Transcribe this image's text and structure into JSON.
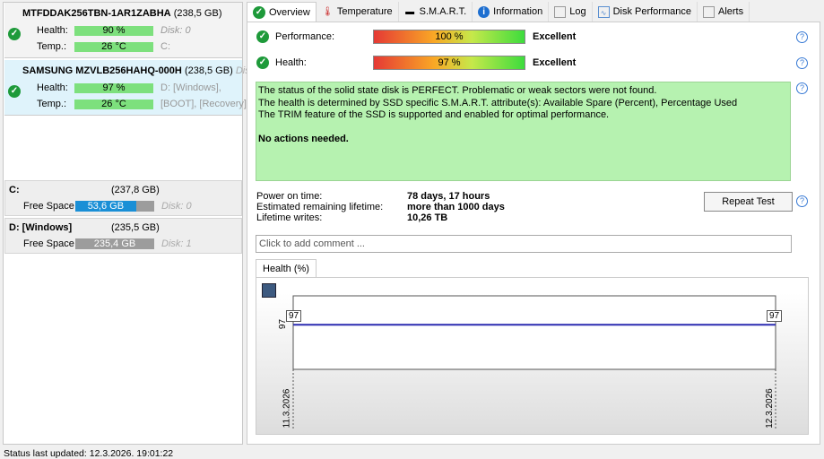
{
  "disks": [
    {
      "name": "MTFDDAK256TBN-1AR1ZABHA",
      "size": "(238,5 GB)",
      "extra": "",
      "health_label": "Health:",
      "health": "90 %",
      "temp_label": "Temp.:",
      "temp": "26 °C",
      "note1": "Disk: 0",
      "note2": "C:"
    },
    {
      "name": "SAMSUNG MZVLB256HAHQ-000H",
      "size": "(238,5 GB)",
      "extra": "Dis",
      "health_label": "Health:",
      "health": "97 %",
      "temp_label": "Temp.:",
      "temp": "26 °C",
      "note1": "D: [Windows],",
      "note2": "[BOOT], [Recovery]"
    }
  ],
  "volumes": [
    {
      "name": "C:",
      "size": "(237,8 GB)",
      "free_label": "Free Space",
      "free": "53,6 GB",
      "free_fraction": 0.77,
      "fill_color": "#1a8fd6",
      "disk": "Disk: 0"
    },
    {
      "name": "D: [Windows]",
      "size": "(235,5 GB)",
      "free_label": "Free Space",
      "free": "235,4 GB",
      "free_fraction": 1.0,
      "fill_color": "#9c9c9c",
      "disk": "Disk: 1"
    }
  ],
  "tabs": [
    "Overview",
    "Temperature",
    "S.M.A.R.T.",
    "Information",
    "Log",
    "Disk Performance",
    "Alerts"
  ],
  "overview": {
    "performance_label": "Performance:",
    "performance": "100 %",
    "performance_rating": "Excellent",
    "health_label": "Health:",
    "health": "97 %",
    "health_rating": "Excellent",
    "status_lines": [
      "The status of the solid state disk is PERFECT. Problematic or weak sectors were not found.",
      "The health is determined by SSD specific S.M.A.R.T. attribute(s):  Available Spare (Percent), Percentage Used",
      "The TRIM feature of the SSD is supported and enabled for optimal performance."
    ],
    "status_action": "No actions needed.",
    "power_on_label": "Power on time:",
    "power_on": "78 days, 17 hours",
    "remaining_label": "Estimated remaining lifetime:",
    "remaining": "more than 1000 days",
    "writes_label": "Lifetime writes:",
    "writes": "10,26 TB",
    "repeat_test": "Repeat Test",
    "comment_placeholder": "Click to add comment ...",
    "chart_tab": "Health (%)"
  },
  "chart_data": {
    "type": "line",
    "x": [
      "11.3.2026",
      "12.3.2026"
    ],
    "values": [
      97,
      97
    ],
    "y_tick": "97",
    "point_labels": [
      "97",
      "97"
    ]
  },
  "statusbar": "Status last updated: 12.3.2026. 19:01:22"
}
